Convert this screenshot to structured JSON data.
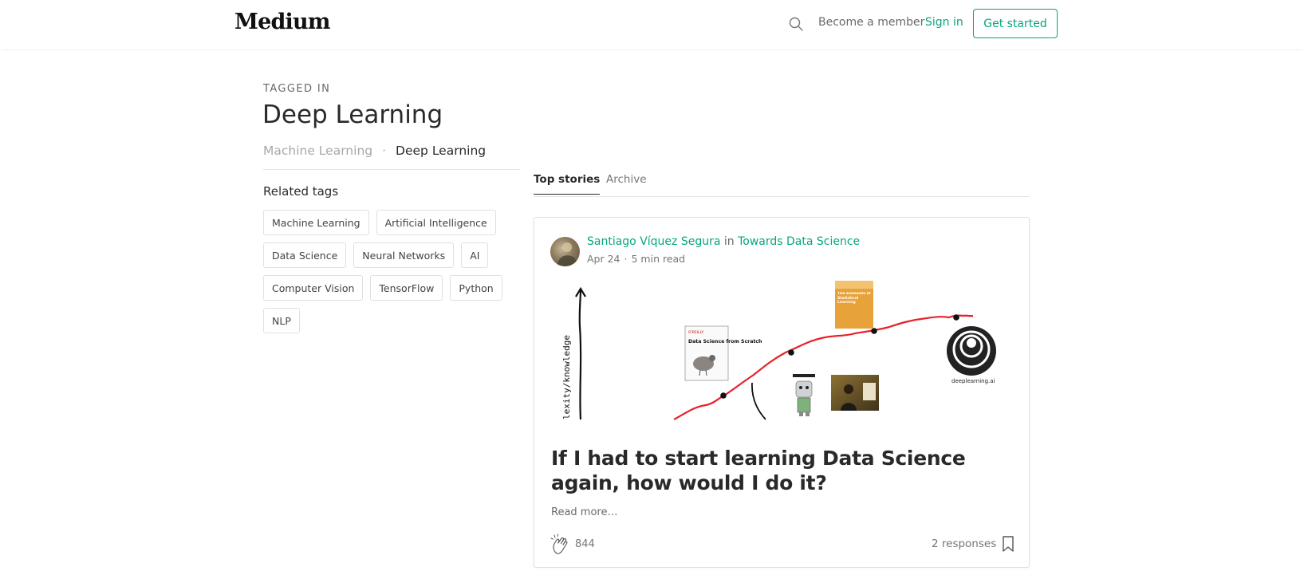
{
  "header": {
    "logo": "Medium",
    "become_member": "Become a member",
    "sign_in": "Sign in",
    "get_started": "Get started"
  },
  "tag": {
    "kicker": "TAGGED IN",
    "title": "Deep Learning",
    "breadcrumb": {
      "parent": "Machine Learning",
      "separator": "·",
      "current": "Deep Learning"
    }
  },
  "related": {
    "title": "Related tags",
    "tags": [
      "Machine Learning",
      "Artificial Intelligence",
      "Data Science",
      "Neural Networks",
      "AI",
      "Computer Vision",
      "TensorFlow",
      "Python",
      "NLP"
    ]
  },
  "tabs": {
    "top": "Top stories",
    "archive": "Archive"
  },
  "story": {
    "author": "Santiago Víquez Segura",
    "in": "in",
    "publication": "Towards Data Science",
    "date": "Apr 24",
    "dot": "·",
    "read_time": "5 min read",
    "title": "If I had to start learning Data Science again, how would I do it?",
    "read_more": "Read more…",
    "claps": "844",
    "responses": "2 responses",
    "image": {
      "axis_label": "lexity/knowledge",
      "book1_brand": "O'REILLY",
      "book1_title": "Data Science from Scratch",
      "book2_title": "The Elements of Statistical Learning",
      "logo_text": "deeplearning.ai"
    }
  },
  "colors": {
    "accent": "#03a87c",
    "curve": "#e8202a"
  }
}
